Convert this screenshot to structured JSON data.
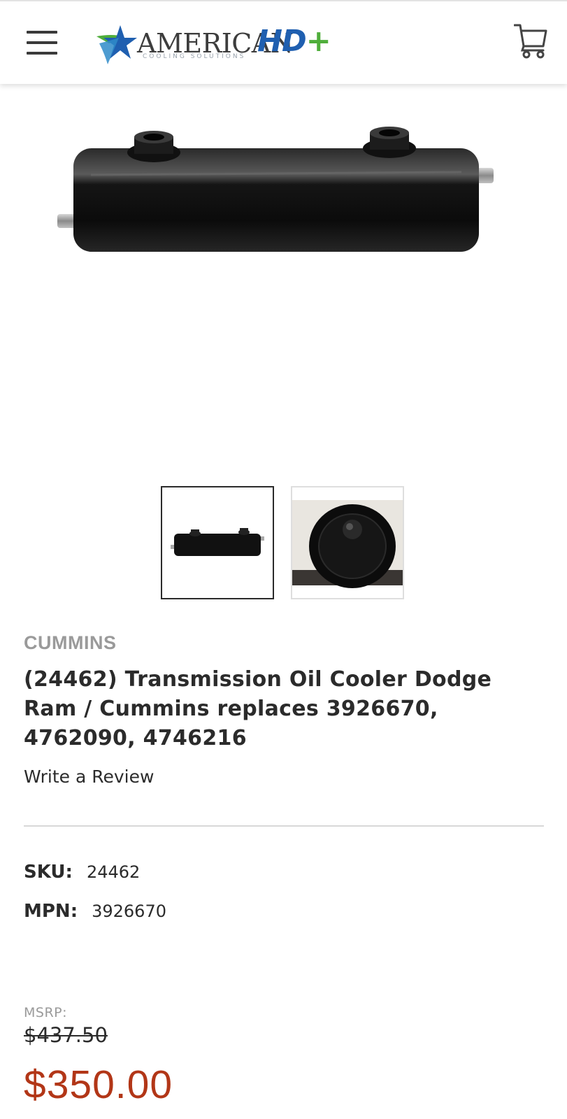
{
  "header": {
    "logo": {
      "word": "AMERICAN",
      "tagline": "COOLING SOLUTIONS",
      "hd": "HD",
      "plus": "+"
    },
    "icons": [
      "hamburger-menu-icon",
      "shopping-cart-icon"
    ]
  },
  "product": {
    "brand": "CUMMINS",
    "title": "(24462) Transmission Oil Cooler Dodge Ram / Cummins replaces 3926670, 4762090, 4746216",
    "review_link": "Write a Review",
    "sku_label": "SKU:",
    "sku": "24462",
    "mpn_label": "MPN:",
    "mpn": "3926670",
    "msrp_label": "MSRP:",
    "msrp": "$437.50",
    "price": "$350.00"
  },
  "gallery": {
    "thumbnails": [
      "side view",
      "end view"
    ],
    "selected_index": 0
  },
  "colors": {
    "price": "#b23617",
    "brand": "#9a9a9a",
    "logo_blue": "#1f5fb0",
    "logo_green": "#4fae3b",
    "text": "#2b2b2b"
  }
}
